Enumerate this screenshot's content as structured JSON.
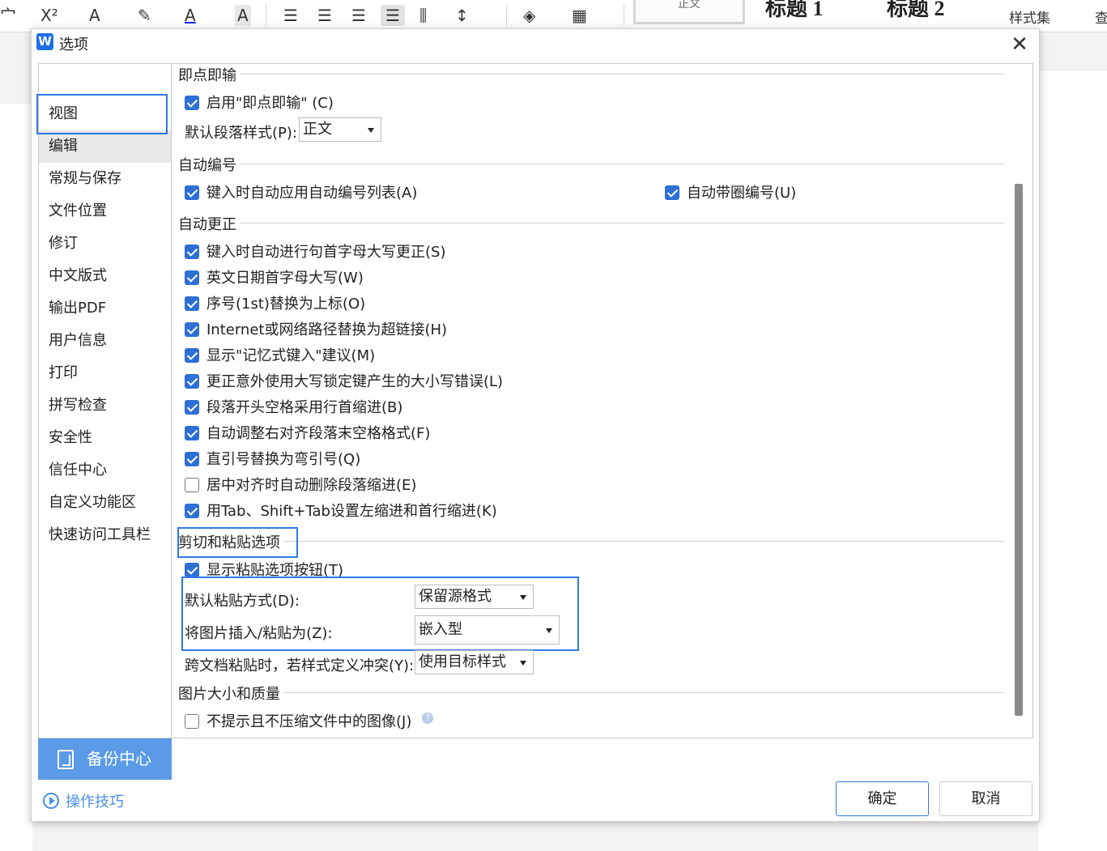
{
  "ribbon": {
    "frag_left": "宀",
    "superscript": "X²",
    "font_a": "A",
    "font_color_a": "A",
    "shade_a": "A",
    "style_normal": "正文",
    "heading1": "标题 1",
    "heading2": "标题 2",
    "style_set": "样式集",
    "right_frag": "查"
  },
  "dialog": {
    "title": "选项",
    "logo": "W",
    "close": "✕"
  },
  "nav": {
    "items": [
      {
        "label": "视图"
      },
      {
        "label": "编辑"
      },
      {
        "label": "常规与保存"
      },
      {
        "label": "文件位置"
      },
      {
        "label": "修订"
      },
      {
        "label": "中文版式"
      },
      {
        "label": "输出PDF"
      },
      {
        "label": "用户信息"
      },
      {
        "label": "打印"
      },
      {
        "label": "拼写检查"
      },
      {
        "label": "安全性"
      },
      {
        "label": "信任中心"
      },
      {
        "label": "自定义功能区"
      },
      {
        "label": "快速访问工具栏"
      }
    ],
    "backup": "备份中心",
    "tips": "操作技巧"
  },
  "sections": {
    "click_type": {
      "title": "即点即输",
      "enable": "启用\"即点即输\" (C)",
      "default_style_label": "默认段落样式(P):",
      "default_style_value": "正文"
    },
    "auto_number": {
      "title": "自动编号",
      "apply_list": "键入时自动应用自动编号列表(A)",
      "circle_number": "自动带圈编号(U)"
    },
    "auto_correct": {
      "title": "自动更正",
      "options": [
        {
          "label": "键入时自动进行句首字母大写更正(S)",
          "checked": true
        },
        {
          "label": "英文日期首字母大写(W)",
          "checked": true
        },
        {
          "label": "序号(1st)替换为上标(O)",
          "checked": true
        },
        {
          "label": "Internet或网络路径替换为超链接(H)",
          "checked": true
        },
        {
          "label": "显示\"记忆式键入\"建议(M)",
          "checked": true
        },
        {
          "label": "更正意外使用大写锁定键产生的大小写错误(L)",
          "checked": true
        },
        {
          "label": "段落开头空格采用行首缩进(B)",
          "checked": true
        },
        {
          "label": "自动调整右对齐段落末空格格式(F)",
          "checked": true
        },
        {
          "label": "直引号替换为弯引号(Q)",
          "checked": true
        },
        {
          "label": "居中对齐时自动删除段落缩进(E)",
          "checked": false
        },
        {
          "label": "用Tab、Shift+Tab设置左缩进和首行缩进(K)",
          "checked": true
        }
      ]
    },
    "cut_paste": {
      "title": "剪切和粘贴选项",
      "show_button": "显示粘贴选项按钮(T)",
      "default_paste_label": "默认粘贴方式(D):",
      "default_paste_value": "保留源格式",
      "image_paste_label": "将图片插入/粘贴为(Z):",
      "image_paste_value": "嵌入型",
      "cross_doc_label": "跨文档粘贴时，若样式定义冲突(Y):",
      "cross_doc_value": "使用目标样式"
    },
    "image_quality": {
      "title": "图片大小和质量",
      "no_compress": "不提示且不压缩文件中的图像(J)",
      "help": "?"
    }
  },
  "buttons": {
    "ok": "确定",
    "cancel": "取消"
  },
  "colors": {
    "accent": "#2f79e6",
    "checkbox": "#2d6fd4",
    "backup_bg": "#5a9ae6"
  }
}
